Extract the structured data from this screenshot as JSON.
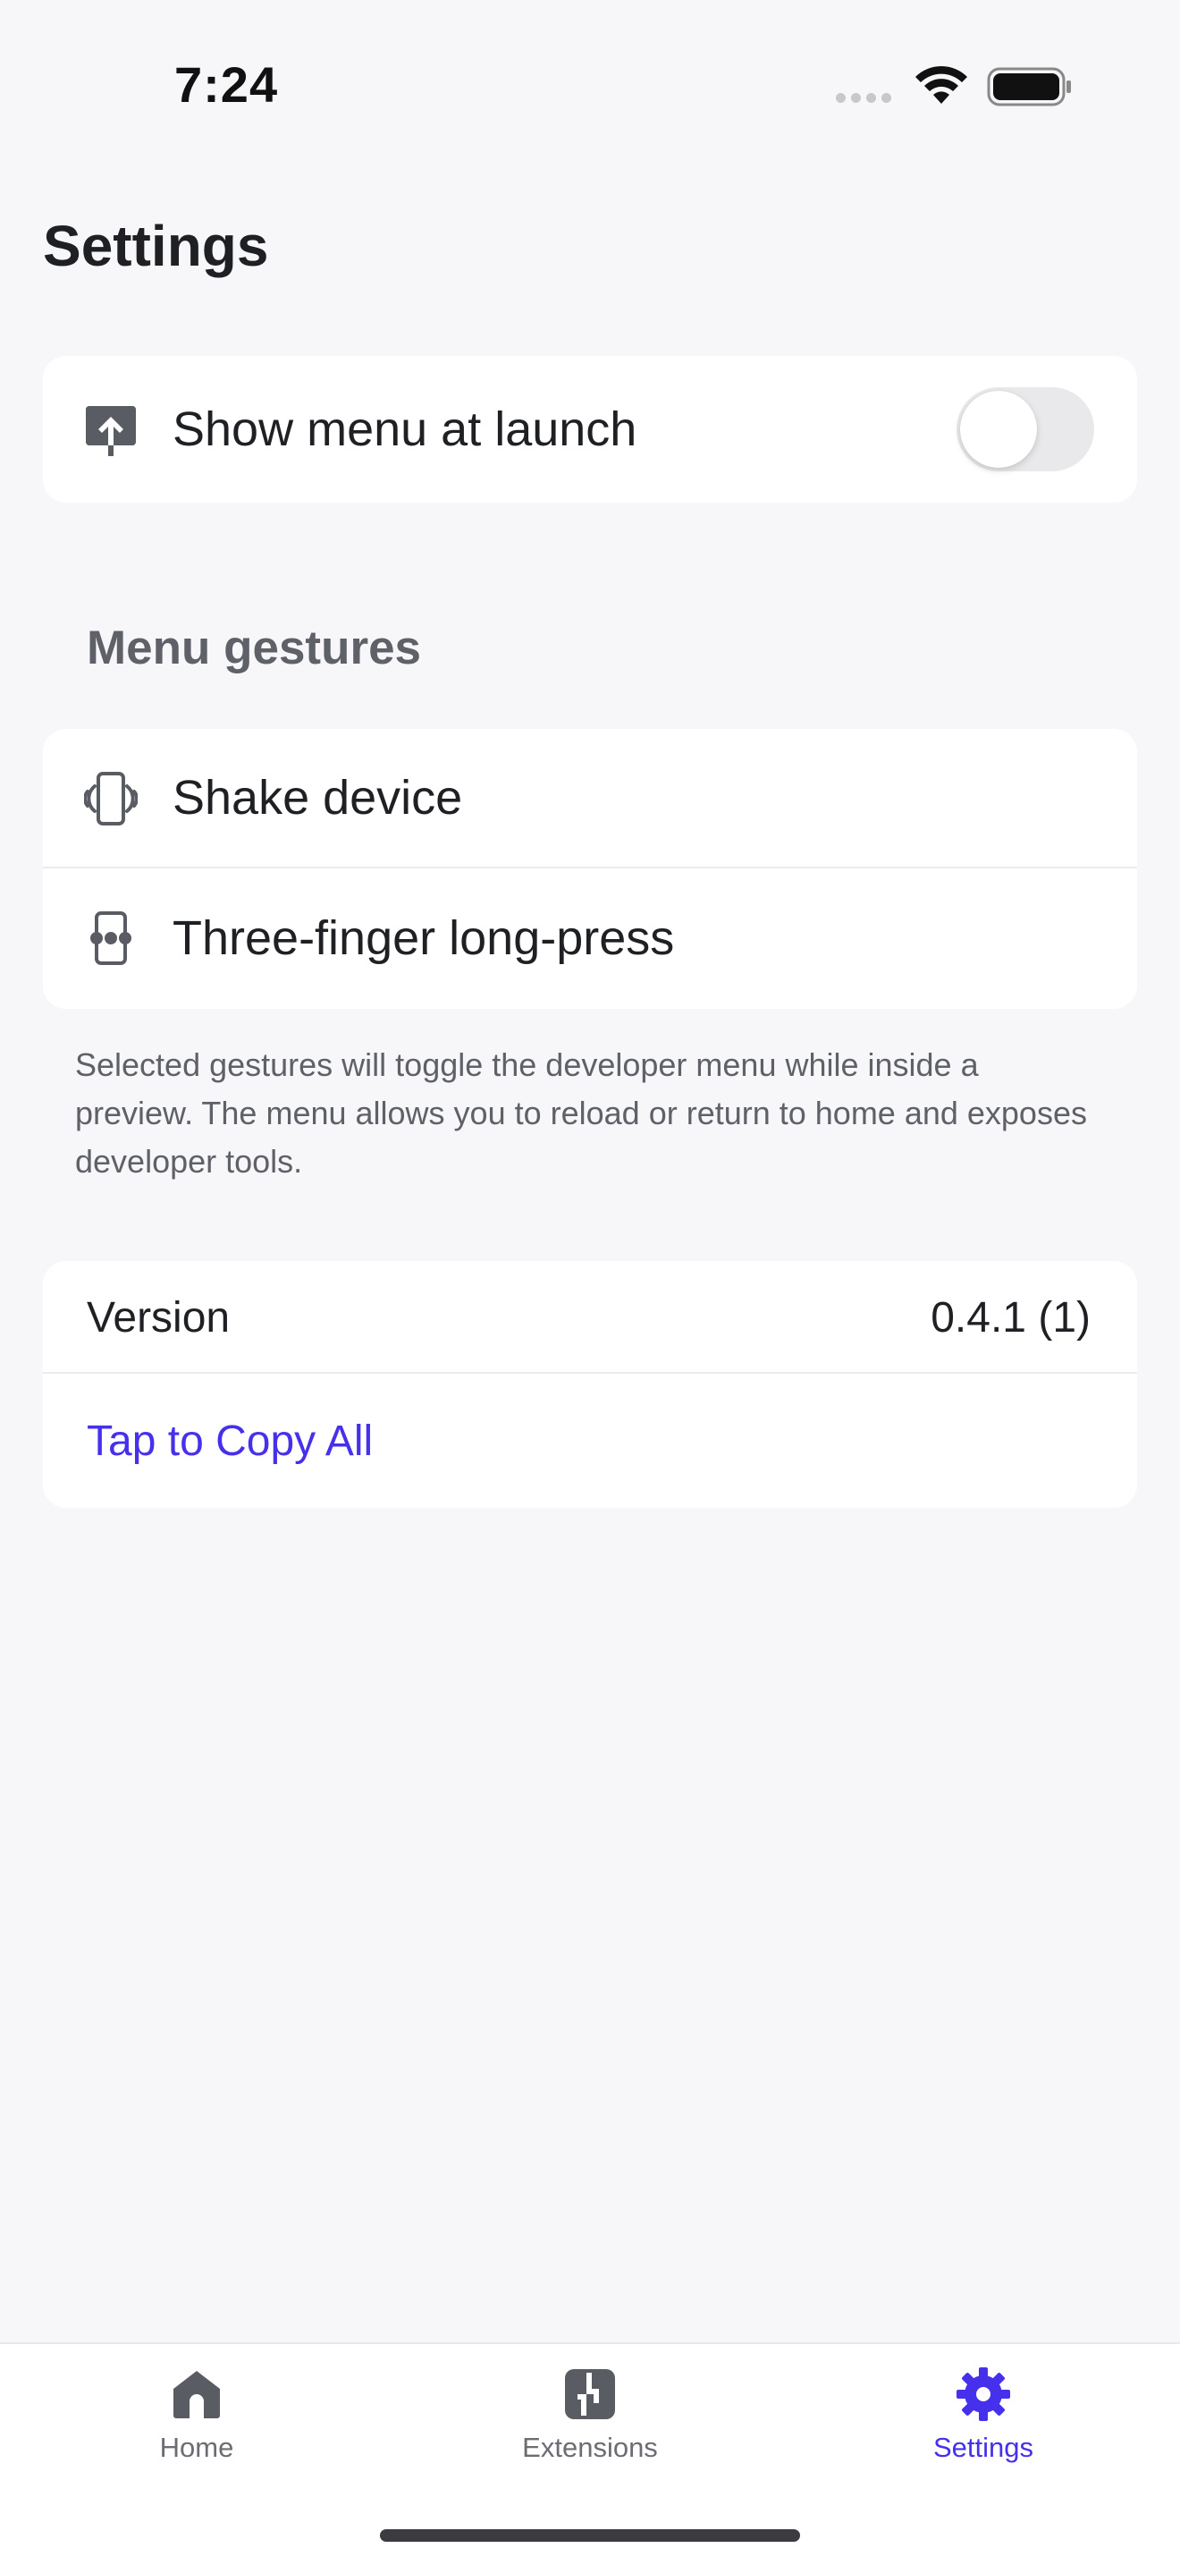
{
  "status_bar": {
    "time": "7:24",
    "icons": [
      "signal-dots-icon",
      "wifi-icon",
      "battery-icon"
    ]
  },
  "page": {
    "title": "Settings"
  },
  "launch": {
    "icon": "upload-arrow-icon",
    "label": "Show menu at launch",
    "toggle_on": false
  },
  "gestures": {
    "header": "Menu gestures",
    "items": [
      {
        "icon": "shake-device-icon",
        "label": "Shake device"
      },
      {
        "icon": "three-finger-press-icon",
        "label": "Three-finger long-press"
      }
    ],
    "footnote": "Selected gestures will toggle the developer menu while inside a preview. The menu allows you to reload or return to home and exposes developer tools."
  },
  "about": {
    "version_label": "Version",
    "version_value": "0.4.1 (1)",
    "copy_label": "Tap to Copy All"
  },
  "tab_bar": {
    "items": [
      {
        "label": "Home",
        "icon": "home-icon",
        "active": false
      },
      {
        "label": "Extensions",
        "icon": "extensions-icon",
        "active": false
      },
      {
        "label": "Settings",
        "icon": "gear-icon",
        "active": true
      }
    ]
  },
  "colors": {
    "accent": "#4630eb",
    "background": "#f7f7f9",
    "card": "#ffffff",
    "secondary_text": "#5f6168",
    "toggle_off": "#e9e9eb"
  }
}
